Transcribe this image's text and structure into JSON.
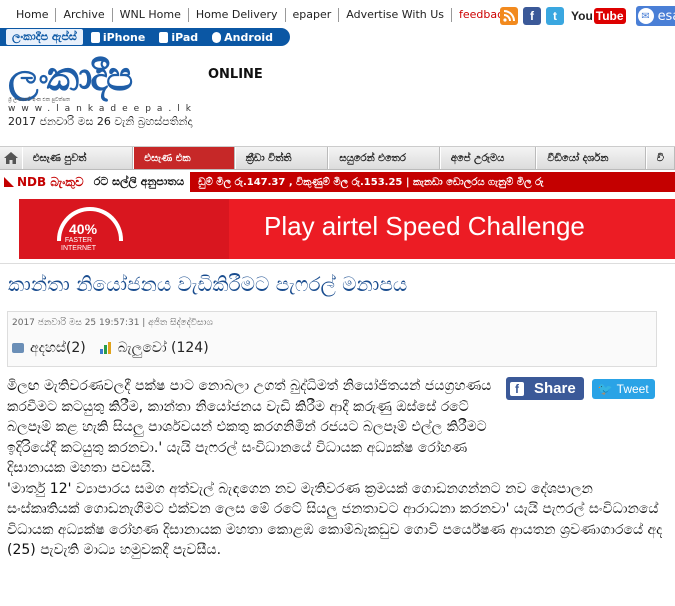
{
  "topnav": {
    "links": [
      "Home",
      "Archive",
      "WNL Home",
      "Home Delivery",
      "epaper",
      "Advertise With Us",
      "feedback"
    ],
    "youtube_left": "You",
    "youtube_right": "Tube",
    "esa_label": "esa"
  },
  "appbar": {
    "label": "ලංකාදීප ඇප්ස්",
    "items": [
      "iPhone",
      "iPad",
      "Android"
    ]
  },
  "logo": {
    "name": "ලංකාදීප",
    "suffix": "ONLINE",
    "tagline": "ශ්‍රී ලංකාවේ අංක එක පුවත්පත",
    "url": "www.lankadeepa.lk"
  },
  "date_line": "2017 ජනවාරි මස 26 වැනි බ්‍රහස්පතින්දා",
  "mainnav": {
    "tabs": [
      "එසැණ පුවත්",
      "එසැණ එක",
      "ක්‍රීඩා විත්ති",
      "සයුරෙන් එතෙර",
      "අපේ උරුමය",
      "වීඩියෝ දර්ශන",
      "වි"
    ]
  },
  "ticker": {
    "bank": "NDB බැංකුව",
    "label": "රට සල්ලි අනුපාතය",
    "rates": "ඩුම් මිල රු.147.37  ,  විකුණුම් මිල රු.153.25  |  කැනඩා ඩොලරය ගැනුම් මිල රු"
  },
  "banner": {
    "percent": "40%",
    "faster": "FASTER",
    "internet": "INTERNET",
    "text": "Play airtel Speed Challenge"
  },
  "article": {
    "headline": "කාන්තා නියෝජනය වැඩිකිරීමට පැෆරල් මනාපය",
    "meta_line": "2017 ජනවාරි මස 25 19:57:31  |  අජිත සිද්දේවිසාශ",
    "comments_label": "අදහස්(2)",
    "views_label": "බැලුවෝ (124)",
    "share_label": "Share",
    "tweet_label": "Tweet",
    "paragraphs": [
      "මිලඟ මැතිවරණවලදී පක්ෂ පාට නොබලා උගත් බුද්ධිමත් නියෝජිතයන් ජයග්‍රහණය කරවීමට කටයුතු කිරීම, කාන්තා නියෝජනය වැඩි කිරීම ආදී කරුණු ඔස්සේ රටේ බලපෑම් කළ හැකි සියලු පාර්ශවයන් එකතු කරගනිමින් රජයට බලපෑම් එල්ල කිරීමට ඉදිරියේදී කටයුතු කරනවා.' යැයි පැෆරල් සංවිධානයේ විධායක අධ්‍යක්ෂ රෝහණ දිසානායක මහතා පවසයි.",
      "'මාර්තු 12' ව්‍යාපාරය සමග අත්වැල් බැඳගෙන නව මැතිවරණ ක්‍රමයක් ගොඩනගන්නට නව දේශපාලන සංස්කෘතියක් ගොඩනැගීමට එක්වන ලෙස මේ රටේ සියලු ජනතාවට ආරාධනා කරනවා' යැයි පැෆරල් සංවිධානයේ විධායක අධ්‍යක්ෂ රෝහණ දිසානායක මහතා කොළඹ කොම්බැකඩුව ගොවි පර්යේෂණ ආයතන ශ්‍රවණාගාරයේ අද (25) පැවැති මාධ්‍ය හමුවකදී පැවසීය."
    ]
  },
  "colors": {
    "brand_blue": "#1f5ea8",
    "nav_red": "#c62828",
    "ticker_red": "#c40000",
    "headline_blue": "#1a4d8f"
  }
}
